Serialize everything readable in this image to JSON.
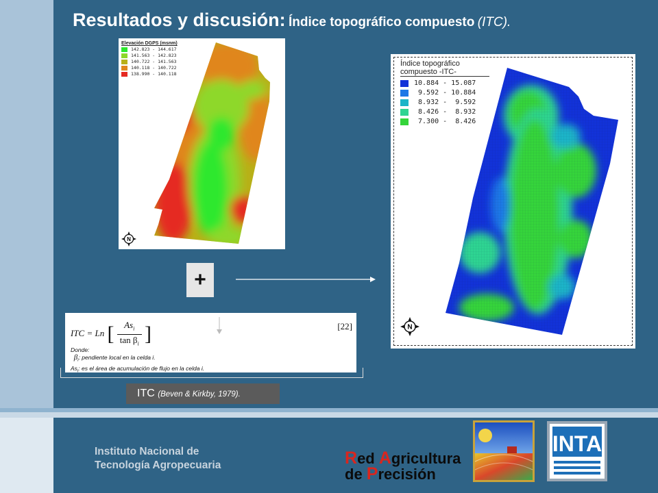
{
  "slide": {
    "title_main": "Resultados y discusión:",
    "title_sub": "Índice topográfico compuesto",
    "title_abbrev": "(ITC)."
  },
  "elevation_map": {
    "legend_title": "Elevación DGPS (msnm)",
    "legend": [
      {
        "range": "142.823 - 144.617",
        "color": "#2ee82e"
      },
      {
        "range": "141.563 - 142.823",
        "color": "#8ed82a"
      },
      {
        "range": "140.722 - 141.563",
        "color": "#b8b018"
      },
      {
        "range": "140.118 - 140.722",
        "color": "#e0861c"
      },
      {
        "range": "138.990 - 140.118",
        "color": "#e52a22"
      }
    ],
    "north_label": "N"
  },
  "itc_map": {
    "legend_title_line1": "Índice topográfico",
    "legend_title_line2": "compuesto -ITC-",
    "legend": [
      {
        "range": "10.884 - 15.087",
        "color": "#1232d8"
      },
      {
        "range": " 9.592 - 10.884",
        "color": "#1c78e6"
      },
      {
        "range": " 8.932 -  9.592",
        "color": "#1ab4c8"
      },
      {
        "range": " 8.426 -  8.932",
        "color": "#2fd492"
      },
      {
        "range": " 7.300 -  8.426",
        "color": "#34d43a"
      }
    ],
    "north_label": "N"
  },
  "operator": {
    "plus": "+"
  },
  "formula": {
    "lhs": "ITC = Ln",
    "numerator": "As",
    "numerator_sub": "i",
    "denominator": "tan β",
    "denominator_sub": "i",
    "eq_number": "[22]",
    "note_header": "Donde:",
    "note_beta": "β",
    "note_beta_sub": "i",
    "note_beta_text": ": pendiente local en la celda i.",
    "note_as": "As",
    "note_as_sub": "i",
    "note_as_text": ": es el área de acumulación de flujo en la celda i."
  },
  "reference": {
    "main": "ITC",
    "citation": "(Beven & Kirkby, 1979)."
  },
  "footer": {
    "institute_line1": "Instituto Nacional de",
    "institute_line2": "Tecnología Agropecuaria",
    "rap_cap1": "R",
    "rap_word1": "ed ",
    "rap_cap2": "A",
    "rap_word2": "gricultura",
    "rap_word3": "de ",
    "rap_cap3": "P",
    "rap_word4": "recisión",
    "inta_text": "INTA"
  },
  "colors": {
    "background": "#2f6386",
    "left_band": "#a9c3d9",
    "title_text": "#ffffff",
    "ref_box": "#5b5b5b"
  }
}
